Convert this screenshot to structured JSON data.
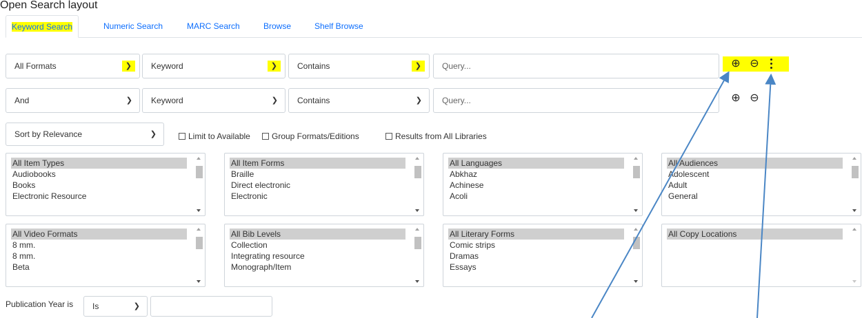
{
  "caption": "Open Search layout",
  "tabs": [
    {
      "label": "Keyword Search",
      "active": true
    },
    {
      "label": "Numeric Search"
    },
    {
      "label": "MARC Search"
    },
    {
      "label": "Browse"
    },
    {
      "label": "Shelf Browse"
    }
  ],
  "row1": {
    "format": "All Formats",
    "field": "Keyword",
    "operator": "Contains",
    "query_placeholder": "Query..."
  },
  "row2": {
    "bool": "And",
    "field": "Keyword",
    "operator": "Contains",
    "query_placeholder": "Query..."
  },
  "sort": {
    "value": "Sort by Relevance"
  },
  "checkboxes": [
    "Limit to Available",
    "Group Formats/Editions",
    "Results from All Libraries"
  ],
  "filters": [
    {
      "items": [
        "All Item Types",
        "Audiobooks",
        "Books",
        "Electronic Resource"
      ]
    },
    {
      "items": [
        "All Item Forms",
        "Braille",
        "Direct electronic",
        "Electronic"
      ]
    },
    {
      "items": [
        "All Languages",
        "Abkhaz",
        "Achinese",
        "Acoli"
      ]
    },
    {
      "items": [
        "All Audiences",
        "Adolescent",
        "Adult",
        "General"
      ]
    },
    {
      "items": [
        "All Video Formats",
        "8 mm.",
        "8 mm.",
        "Beta"
      ]
    },
    {
      "items": [
        "All Bib Levels",
        "Collection",
        "Integrating resource",
        "Monograph/Item"
      ]
    },
    {
      "items": [
        "All Literary Forms",
        "Comic strips",
        "Dramas",
        "Essays"
      ]
    },
    {
      "items": [
        "All Copy Locations"
      ]
    }
  ],
  "pubyear": {
    "label": "Publication Year is",
    "operator": "Is",
    "value": ""
  },
  "icons": {
    "add": "plus-circle",
    "remove": "minus-circle",
    "more": "vertical-ellipsis"
  },
  "colors": {
    "highlight": "#ffff00",
    "link": "#0d6efd",
    "arrow": "#4a86c5",
    "selected_option": "#cfcfcf"
  }
}
